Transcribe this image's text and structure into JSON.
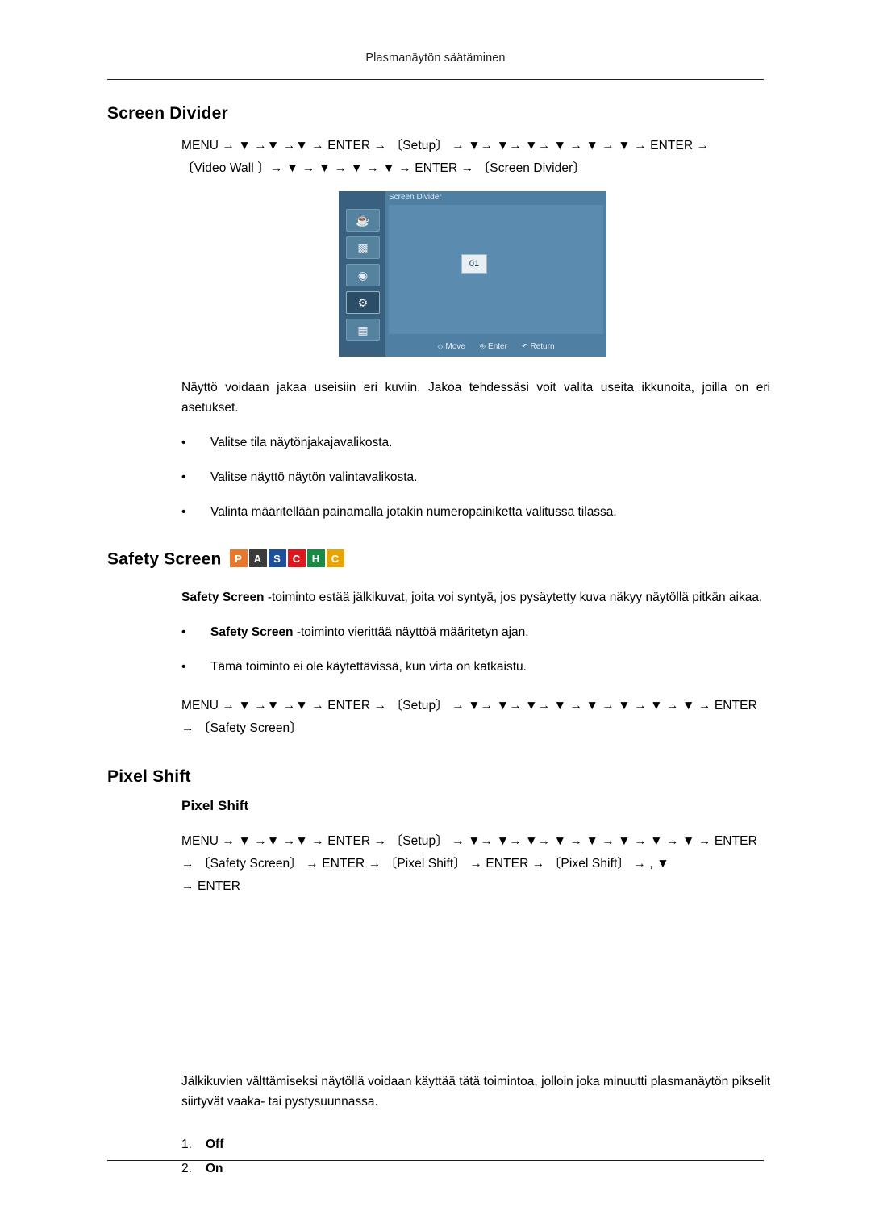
{
  "header": {
    "running_title": "Plasmanäytön säätäminen"
  },
  "sections": {
    "screen_divider": {
      "title": "Screen Divider",
      "nav_line1_pre": "MENU",
      "nav_line1": "MENU → ▼ →▼ →▼ → ENTER → 〔Setup〕 → ▼→ ▼→ ▼→ ▼ → ▼ → ▼ → ENTER →",
      "nav_line2": "〔Video Wall 〕→ ▼ → ▼ → ▼ → ▼ → ENTER → 〔Screen Divider〕",
      "osd": {
        "title": "Screen Divider",
        "cell_label": "01",
        "foot_move": "Move",
        "foot_enter": "Enter",
        "foot_return": "Return"
      },
      "paragraph": "Näyttö voidaan jakaa useisiin eri kuviin. Jakoa tehdessäsi voit valita useita ikkunoita, joilla on eri asetukset.",
      "bullets": [
        "Valitse tila näytönjakajavalikosta.",
        "Valitse näyttö näytön valintavalikosta.",
        "Valinta määritellään painamalla jotakin numeropainiketta valitussa tilassa."
      ]
    },
    "safety_screen": {
      "title": "Safety Screen",
      "tags": [
        {
          "letter": "P",
          "color": "#e8772e"
        },
        {
          "letter": "A",
          "color": "#3b3b3b"
        },
        {
          "letter": "S",
          "color": "#1d4f9c"
        },
        {
          "letter": "C",
          "color": "#e0171c"
        },
        {
          "letter": "H",
          "color": "#178a43"
        },
        {
          "letter": "C",
          "color": "#e8a400"
        }
      ],
      "paragraph_bold": "Safety Screen",
      "paragraph_rest": " -toiminto estää jälkikuvat, joita voi syntyä, jos pysäytetty kuva näkyy näytöllä pitkän aikaa.",
      "bullet1_bold": "Safety Screen",
      "bullet1_rest": " -toiminto vierittää näyttöä määritetyn ajan.",
      "bullet2": "Tämä toiminto ei ole käytettävissä, kun virta on katkaistu.",
      "nav_line1": "MENU → ▼ →▼ →▼ → ENTER → 〔Setup〕 → ▼→ ▼→ ▼→ ▼ → ▼ → ▼ → ▼ → ▼ → ENTER",
      "nav_line2": "→ 〔Safety Screen〕"
    },
    "pixel_shift": {
      "title": "Pixel Shift",
      "subtitle": "Pixel Shift",
      "nav_line1": "MENU → ▼ →▼ →▼ → ENTER → 〔Setup〕 → ▼→ ▼→ ▼→ ▼ → ▼ → ▼ → ▼ → ▼ → ENTER",
      "nav_line2": "→ 〔Safety Screen〕 → ENTER → 〔Pixel Shift〕 → ENTER → 〔Pixel Shift〕 →      ,  ▼",
      "nav_line3": "→ ENTER",
      "paragraph": "Jälkikuvien välttämiseksi näytöllä voidaan käyttää tätä toimintoa, jolloin joka minuutti plasmanäytön pikselit siirtyvät vaaka- tai pystysuunnassa.",
      "options": [
        {
          "num": "1.",
          "label": "Off"
        },
        {
          "num": "2.",
          "label": "On"
        }
      ]
    }
  }
}
